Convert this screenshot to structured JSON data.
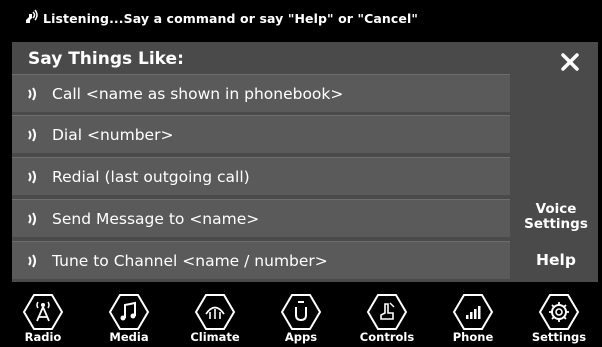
{
  "status": {
    "text": "Listening...Say a command or say \"Help\" or \"Cancel\""
  },
  "panel": {
    "title": "Say Things Like:"
  },
  "commands": [
    {
      "label": "Call <name as shown in phonebook>"
    },
    {
      "label": "Dial <number>"
    },
    {
      "label": "Redial (last outgoing call)"
    },
    {
      "label": "Send Message to <name>"
    },
    {
      "label": "Tune to Channel <name / number>"
    }
  ],
  "side": {
    "voice_settings": "Voice Settings",
    "help": "Help"
  },
  "nav": [
    {
      "label": "Radio",
      "icon": "radio-icon"
    },
    {
      "label": "Media",
      "icon": "music-note-icon"
    },
    {
      "label": "Climate",
      "icon": "climate-icon"
    },
    {
      "label": "Apps",
      "icon": "apps-icon"
    },
    {
      "label": "Controls",
      "icon": "controls-icon"
    },
    {
      "label": "Phone",
      "icon": "phone-signal-icon"
    },
    {
      "label": "Settings",
      "icon": "gear-icon"
    }
  ],
  "colors": {
    "panel": "#4a4a4a",
    "row": "#5a5a5a",
    "background": "#000000",
    "text": "#ffffff"
  }
}
